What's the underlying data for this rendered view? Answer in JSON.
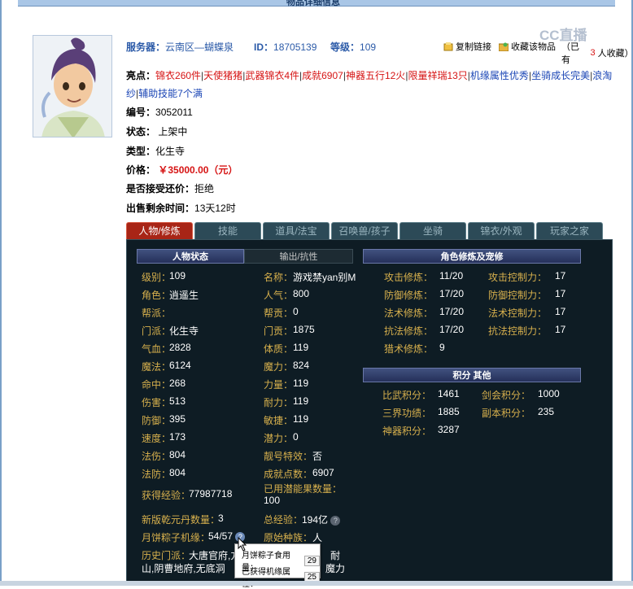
{
  "header": {
    "page_title": "物品详细信息",
    "server_label": "服务器：",
    "server_value": "云南区—蝴蝶泉",
    "id_label": "ID：",
    "id_value": "18705139",
    "level_label": "等级：",
    "level_value": "109",
    "copy_link": "复制链接",
    "collect": "收藏该物品",
    "collect_count_prefix": "（已有",
    "collect_count": "3",
    "collect_count_suffix": "人收藏）",
    "watermark": "CC直播"
  },
  "highlights": {
    "label": "亮点：",
    "items": [
      {
        "text": "锦衣260件",
        "color": "red"
      },
      {
        "text": "天使猪猪",
        "color": "red"
      },
      {
        "text": "武器锦衣4件",
        "color": "red"
      },
      {
        "text": "成就6907",
        "color": "red"
      },
      {
        "text": "神器五行12火",
        "color": "red"
      },
      {
        "text": "限量祥瑞13只",
        "color": "red"
      },
      {
        "text": "机缘属性优秀",
        "color": "blue"
      },
      {
        "text": "坐骑成长完美",
        "color": "blue"
      },
      {
        "text": "浪淘纱",
        "color": "blue"
      },
      {
        "text": "辅助技能7个满",
        "color": "blue"
      }
    ]
  },
  "info": {
    "number_label": "编号：",
    "number_value": "3052011",
    "status_label": "状态：",
    "status_value": "上架中",
    "type_label": "类型：",
    "type_value": "化生寺",
    "price_label": "价格：",
    "price_value": "￥35000.00（元）",
    "bargain_label": "是否接受还价：",
    "bargain_value": "拒绝",
    "remaining_label": "出售剩余时间：",
    "remaining_value": "13天12时"
  },
  "tabs": [
    "人物/修炼",
    "技能",
    "道具/法宝",
    "召唤兽/孩子",
    "坐骑",
    "锦衣/外观",
    "玩家之家"
  ],
  "panel": {
    "subtabs": [
      "人物状态",
      "输出/抗性"
    ],
    "left_col": [
      {
        "k": "级别：",
        "v": "109"
      },
      {
        "k": "角色：",
        "v": "逍遥生"
      },
      {
        "k": "帮派：",
        "v": ""
      },
      {
        "k": "门派：",
        "v": "化生寺"
      },
      {
        "k": "气血：",
        "v": "2828"
      },
      {
        "k": "魔法：",
        "v": "6124"
      },
      {
        "k": "命中：",
        "v": "268"
      },
      {
        "k": "伤害：",
        "v": "513"
      },
      {
        "k": "防御：",
        "v": "395"
      },
      {
        "k": "速度：",
        "v": "173"
      },
      {
        "k": "法伤：",
        "v": "804"
      },
      {
        "k": "法防：",
        "v": "804"
      }
    ],
    "right_col": [
      {
        "k": "名称：",
        "v": "游戏禁yan别M"
      },
      {
        "k": "人气：",
        "v": "800"
      },
      {
        "k": "帮贡：",
        "v": "0"
      },
      {
        "k": "门贡：",
        "v": "1875"
      },
      {
        "k": "体质：",
        "v": "119"
      },
      {
        "k": "魔力：",
        "v": "824"
      },
      {
        "k": "力量：",
        "v": "119"
      },
      {
        "k": "耐力：",
        "v": "119"
      },
      {
        "k": "敏捷：",
        "v": "119"
      },
      {
        "k": "潜力：",
        "v": "0"
      },
      {
        "k": "靓号特效：",
        "v": "否"
      },
      {
        "k": "成就点数：",
        "v": "6907"
      }
    ],
    "exp_label": "获得经验：",
    "exp_value": "77987718",
    "used_pot_label": "已用潜能果数量：",
    "used_pot_value": "100",
    "qianyuan_label": "新版乾元丹数量：",
    "qianyuan_value": "3",
    "total_exp_label": "总经验：",
    "total_exp_value": "194亿",
    "zongzi_label": "月饼粽子机缘：",
    "zongzi_value": "54/57",
    "race_label": "原始种族：",
    "race_value": "人",
    "history_label": "历史门派：",
    "history_value": "大唐官府,方",
    "history_value2": "山,阴曹地府,无底洞",
    "history_tail1": "耐",
    "history_tail2": "魔力",
    "cultivation_header": "角色修炼及宠修",
    "cultivation": [
      {
        "k": "攻击修炼：",
        "v": "11/20",
        "k2": "攻击控制力：",
        "v2": "17"
      },
      {
        "k": "防御修炼：",
        "v": "17/20",
        "k2": "防御控制力：",
        "v2": "17"
      },
      {
        "k": "法术修炼：",
        "v": "17/20",
        "k2": "法术控制力：",
        "v2": "17"
      },
      {
        "k": "抗法修炼：",
        "v": "17/20",
        "k2": "抗法控制力：",
        "v2": "17"
      },
      {
        "k": "猎术修炼：",
        "v": "9",
        "k2": "",
        "v2": ""
      }
    ],
    "score_header": "积分 其他",
    "scores": [
      {
        "k": "比武积分：",
        "v": "1461",
        "k2": "剑会积分：",
        "v2": "1000"
      },
      {
        "k": "三界功绩：",
        "v": "1885",
        "k2": "副本积分：",
        "v2": "235"
      },
      {
        "k": "神器积分：",
        "v": "3287",
        "k2": "",
        "v2": ""
      }
    ]
  },
  "tooltip": {
    "row1_label": "月饼粽子食用量：",
    "row1_value": "29",
    "row2_label": "已获得机缘属性：",
    "row2_value": "25"
  },
  "colors": {
    "accent": "#d61414",
    "panel_bg": "#0e1c24",
    "label_gold": "#d7b04d"
  }
}
